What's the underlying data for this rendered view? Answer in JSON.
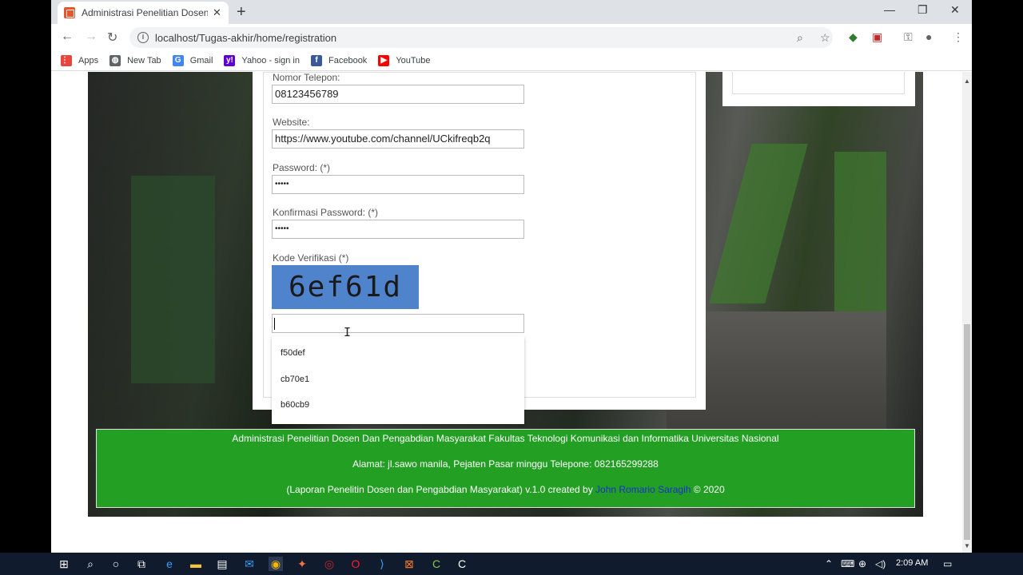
{
  "browser": {
    "tab_title": "Administrasi Penelitian Dosen Da",
    "tab_close": "✕",
    "new_tab": "+",
    "url": "localhost/Tugas-akhir/home/registration",
    "win_min": "—",
    "win_max": "❐",
    "win_close": "✕"
  },
  "bookmarks": [
    {
      "label": "Apps",
      "icon": "apps-grid-icon",
      "color": "#e8453c"
    },
    {
      "label": "New Tab",
      "icon": "globe-icon",
      "color": "#5f6368"
    },
    {
      "label": "Gmail",
      "icon": "google-icon",
      "color": "#4285f4"
    },
    {
      "label": "Yahoo - sign in",
      "icon": "yahoo-icon",
      "color": "#5f01d1"
    },
    {
      "label": "Facebook",
      "icon": "facebook-icon",
      "color": "#3b5998"
    },
    {
      "label": "YouTube",
      "icon": "youtube-icon",
      "color": "#ff0000"
    }
  ],
  "form": {
    "phone_label": "Nomor Telepon:",
    "phone_value": "08123456789",
    "website_label": "Website:",
    "website_value": "https://www.youtube.com/channel/UCkifreqb2q",
    "password_label": "Password: (*)",
    "password_value": "•••••",
    "confirm_label": "Konfirmasi Password: (*)",
    "confirm_value": "•••••",
    "captcha_label": "Kode Verifikasi (*)",
    "captcha_code": "6ef61d",
    "captcha_input": ""
  },
  "autocomplete": [
    "f50def",
    "cb70e1",
    "b60cb9"
  ],
  "footer": {
    "line1": "Administrasi Penelitian Dosen Dan Pengabdian Masyarakat Fakultas Teknologi Komunikasi dan Informatika Universitas Nasional",
    "line2": "Alamat: jl.sawo manila, Pejaten Pasar minggu Telepone: 082165299288",
    "line3_prefix": "(Laporan Penelitin Dosen dan Pengabdian Masyarakat) v.1.0 created by ",
    "line3_author": "John Romario Saragih",
    "line3_suffix": " © 2020"
  },
  "taskbar": {
    "clock": "2:09 AM"
  },
  "colors": {
    "footer_bg": "#23a023",
    "author_link": "#1a2fd1",
    "captcha_bg": "#4f83cc"
  }
}
